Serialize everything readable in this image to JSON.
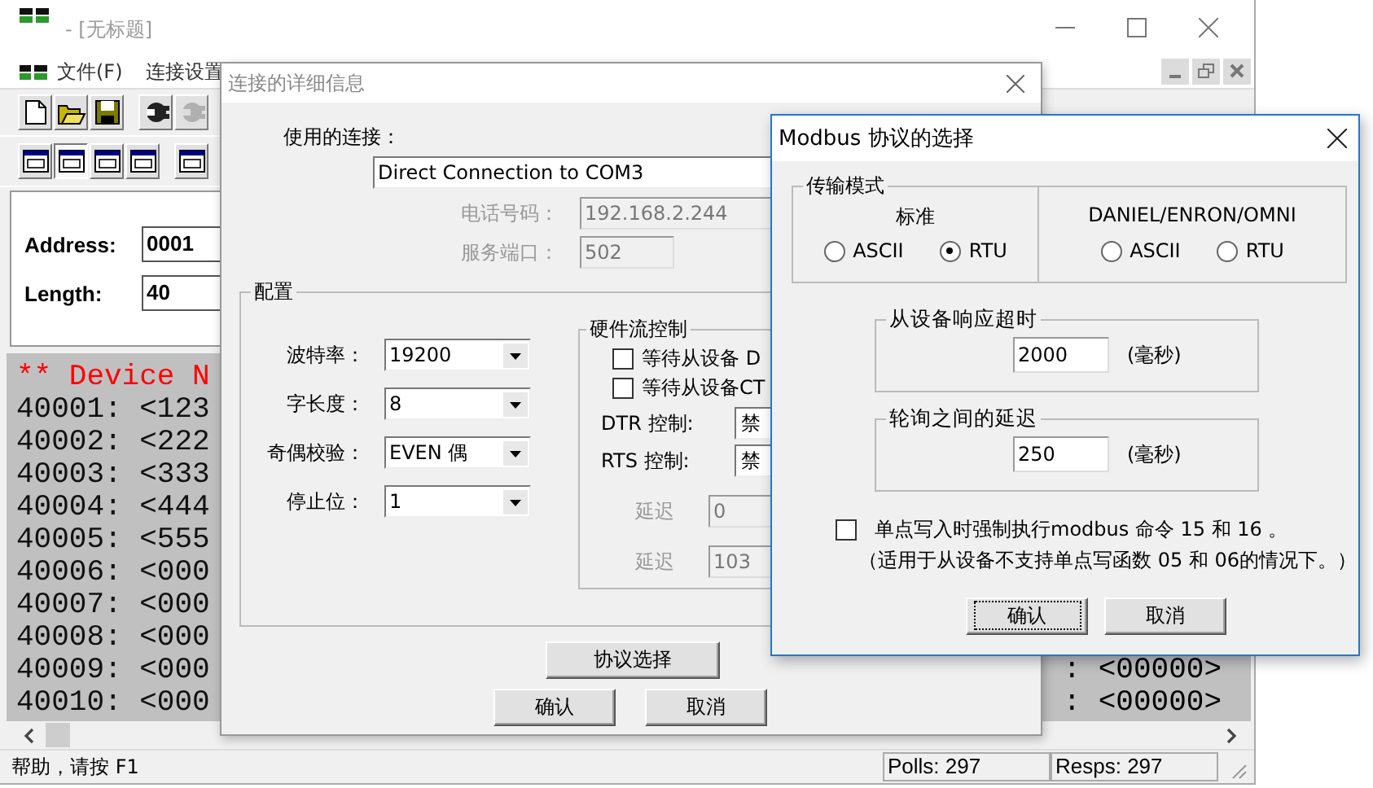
{
  "main_window": {
    "title": "- [无标题]",
    "menus": [
      "文件(F)",
      "连接设置"
    ],
    "connection_buttons": [
      {
        "disabled": false
      },
      {
        "disabled": true
      }
    ],
    "format_buttons": [
      {
        "selected": false
      },
      {
        "selected": true
      },
      {
        "selected": false
      },
      {
        "selected": false
      },
      {
        "selected": false
      }
    ],
    "address_label": "Address:",
    "address": "0001",
    "length_label": "Length:",
    "length": "40",
    "data_header": "** Device N",
    "rows": [
      {
        "text": "40001: <123"
      },
      {
        "text": "40002: <222"
      },
      {
        "text": "40003: <333"
      },
      {
        "text": "40004: <444"
      },
      {
        "text": "40005: <555"
      },
      {
        "text": "40006: <000"
      },
      {
        "text": "40007: <000"
      },
      {
        "text": "40008: <000"
      },
      {
        "text": "40009: <000",
        "tail": ": <00000>"
      },
      {
        "text": "40010: <000",
        "tail": ": <00000>"
      }
    ],
    "status_bar": {
      "help": "帮助，请按 F1",
      "polls": "Polls: 297",
      "resps": "Resps: 297"
    }
  },
  "connection_dialog": {
    "title": "连接的详细信息",
    "connection_label": "使用的连接：",
    "connection": "Direct Connection to COM3",
    "phone": {
      "label": "电话号码：",
      "value": "192.168.2.244",
      "disabled": true
    },
    "port": {
      "label": "服务端口：",
      "value": "502",
      "disabled": true
    },
    "config_title": "配置",
    "settings": [
      {
        "label": "波特率：",
        "value": "19200"
      },
      {
        "label": "字长度：",
        "value": "8"
      },
      {
        "label": "奇偶校验：",
        "value": "EVEN 偶"
      },
      {
        "label": "停止位：",
        "value": "1"
      }
    ],
    "hardware_title": "硬件流控制",
    "waits": [
      {
        "label": "等待从设备 D",
        "checked": false
      },
      {
        "label": "等待从设备CT",
        "checked": false
      }
    ],
    "controls": [
      {
        "label": "DTR 控制:",
        "value": "禁"
      },
      {
        "label": "RTS 控制:",
        "value": "禁"
      }
    ],
    "delays": [
      {
        "label": "延迟",
        "value": "0",
        "disabled": true
      },
      {
        "label": "延迟",
        "value": "103",
        "disabled": true
      }
    ],
    "protocol_button": "协议选择",
    "buttons": [
      "确认",
      "取消"
    ]
  },
  "modbus_dialog": {
    "title": "Modbus 协议的选择",
    "mode_group": "传输模式",
    "modes": [
      {
        "title": "标准",
        "options": [
          {
            "label": "ASCII",
            "selected": false
          },
          {
            "label": "RTU",
            "selected": true
          }
        ]
      },
      {
        "title": "DANIEL/ENRON/OMNI",
        "options": [
          {
            "label": "ASCII",
            "selected": false
          },
          {
            "label": "RTU",
            "selected": false
          }
        ]
      }
    ],
    "timeouts": [
      {
        "title": "从设备响应超时",
        "value": "2000",
        "unit": "(毫秒)"
      },
      {
        "title": "轮询之间的延迟",
        "value": "250",
        "unit": "(毫秒)"
      }
    ],
    "force": {
      "label": "单点写入时强制执行modbus 命令 15 和 16 。",
      "note": "（适用于从设备不支持单点写函数 05 和 06的情况下。）",
      "checked": false
    },
    "buttons": [
      {
        "label": "确认",
        "focused": true
      },
      {
        "label": "取消",
        "focused": false
      }
    ]
  }
}
